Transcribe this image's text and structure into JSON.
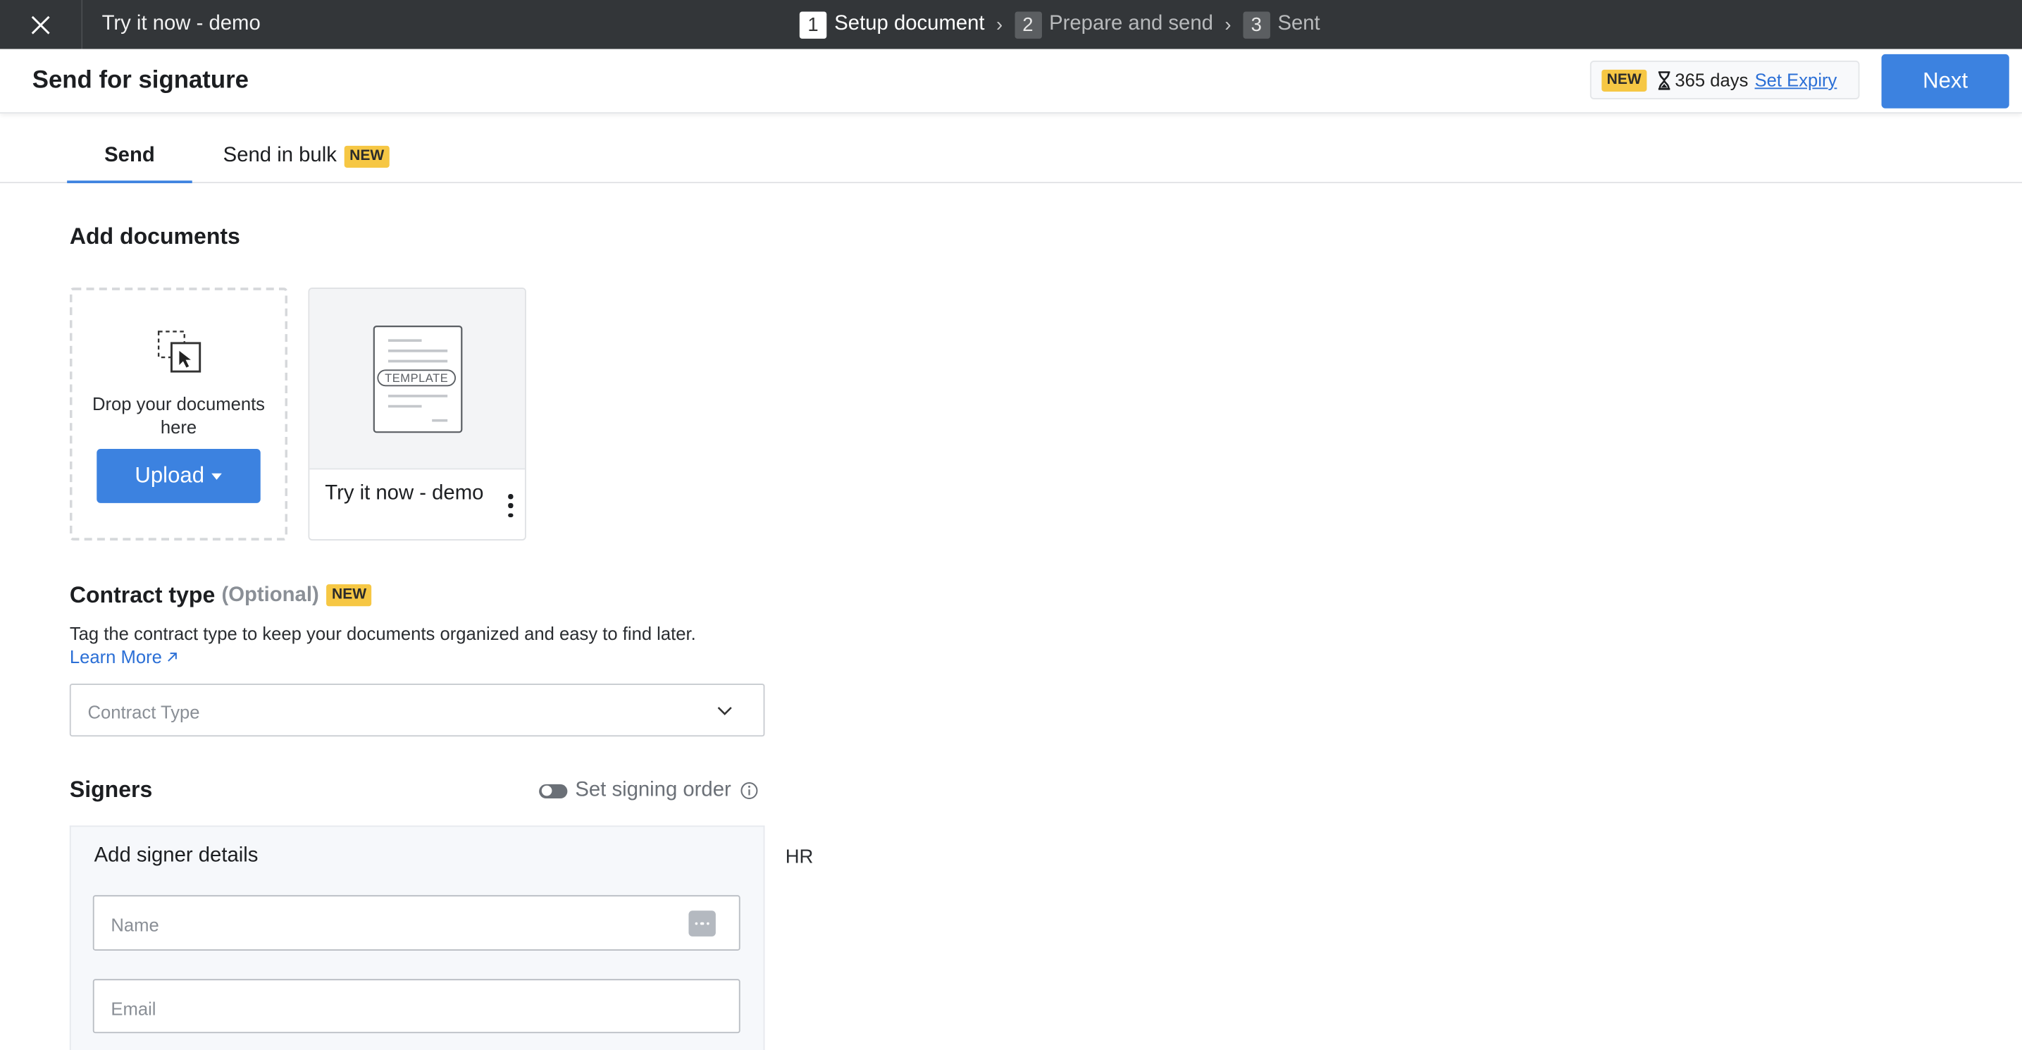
{
  "topbar": {
    "title": "Try it now - demo",
    "steps": [
      {
        "num": "1",
        "label": "Setup document"
      },
      {
        "num": "2",
        "label": "Prepare and send"
      },
      {
        "num": "3",
        "label": "Sent"
      }
    ],
    "separator": "›"
  },
  "header": {
    "title": "Send for signature",
    "new_badge": "NEW",
    "expiry_days": "365 days",
    "set_expiry": "Set Expiry",
    "next": "Next"
  },
  "tabs": {
    "send": "Send",
    "bulk": "Send in bulk",
    "bulk_badge": "NEW"
  },
  "documents": {
    "heading": "Add documents",
    "drop_text": "Drop your documents here",
    "upload": "Upload",
    "card": {
      "name": "Try it now - demo",
      "thumbnail_label": "TEMPLATE"
    }
  },
  "contract": {
    "heading": "Contract type",
    "optional": "(Optional)",
    "badge": "NEW",
    "description": "Tag the contract type to keep your documents organized and easy to find later.",
    "learn_more": "Learn More",
    "placeholder": "Contract Type"
  },
  "signers": {
    "heading": "Signers",
    "signing_order": "Set signing order",
    "panel_title": "Add signer details",
    "name_placeholder": "Name",
    "email_placeholder": "Email",
    "role_label": "HR"
  },
  "colors": {
    "topbar": "#333639",
    "accent": "#3c82e0",
    "badge": "#f6c744",
    "link": "#2b6fd6"
  }
}
